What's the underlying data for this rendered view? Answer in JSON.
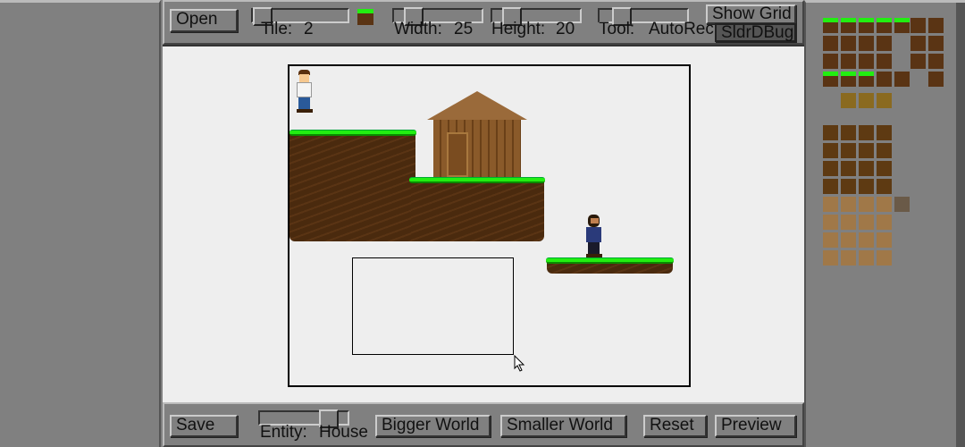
{
  "toolbar_top": {
    "open_label": "Open",
    "tile_label": "Tile:",
    "tile_value": "2",
    "width_label": "Width:",
    "width_value": "25",
    "height_label": "Height:",
    "height_value": "20",
    "tool_label": "Tool:",
    "tool_value": "AutoRec",
    "show_grid_label": "Show Grid",
    "slider_debug_label": "SldrDBug"
  },
  "toolbar_bottom": {
    "save_label": "Save",
    "entity_label": "Entity:",
    "entity_value": "House",
    "bigger_world_label": "Bigger World",
    "smaller_world_label": "Smaller World",
    "reset_label": "Reset",
    "preview_label": "Preview"
  },
  "colors": {
    "panel": "#808080",
    "canvas": "#eeeeee",
    "grass": "#22ee11",
    "dirt": "#4a2a0e",
    "wood": "#9a6a3a"
  },
  "icons": [
    "tile-preview-icon",
    "mouse-cursor-icon"
  ]
}
